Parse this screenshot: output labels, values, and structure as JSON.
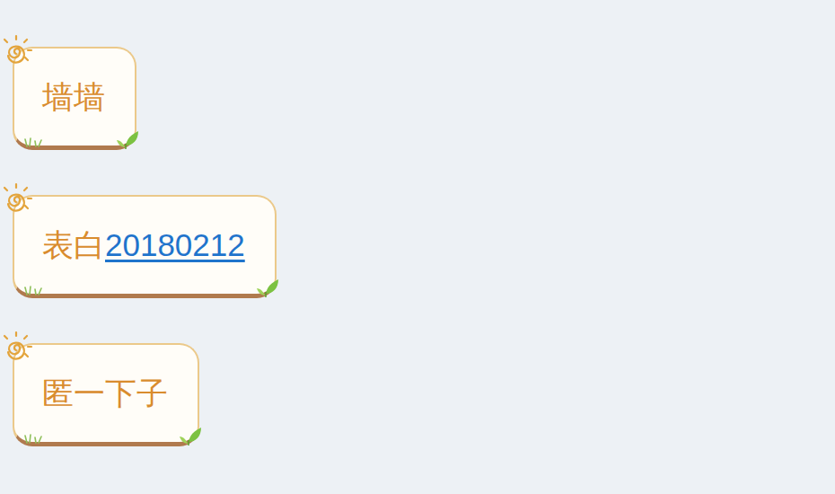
{
  "messages": [
    {
      "segments": [
        {
          "text": "墙墙",
          "kind": "plain"
        }
      ]
    },
    {
      "segments": [
        {
          "text": "表白",
          "kind": "plain"
        },
        {
          "text": "20180212",
          "kind": "link"
        }
      ]
    },
    {
      "segments": [
        {
          "text": "匿一下子",
          "kind": "plain"
        }
      ]
    }
  ]
}
